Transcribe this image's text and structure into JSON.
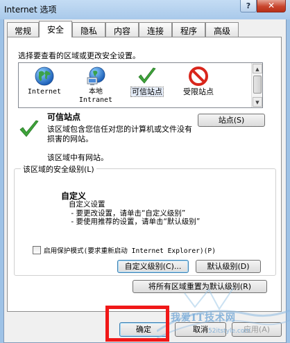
{
  "window": {
    "title": "Internet 选项",
    "help_label": "?",
    "close_label": "✕"
  },
  "tabs": [
    {
      "label": "常规"
    },
    {
      "label": "安全"
    },
    {
      "label": "隐私"
    },
    {
      "label": "内容"
    },
    {
      "label": "连接"
    },
    {
      "label": "程序"
    },
    {
      "label": "高级"
    }
  ],
  "active_tab": "安全",
  "zones": {
    "prompt": "选择要查看的区域或更改安全设置。",
    "items": [
      {
        "label": "Internet",
        "icon": "globe-icon"
      },
      {
        "label": "本地\nIntranet",
        "icon": "local-intranet-icon"
      },
      {
        "label": "可信站点",
        "icon": "check-icon",
        "selected": true
      },
      {
        "label": "受限站点",
        "icon": "no-entry-icon"
      }
    ],
    "selected": {
      "name": "可信站点",
      "description": "该区域包含您信任对您的计算机或文件没有损害的网站。",
      "sites_note": "该区域中有网站。",
      "sites_button": "站点(S)"
    }
  },
  "security_level": {
    "group_label": "该区域的安全级别(L)",
    "level_name": "自定义",
    "description_lines": [
      "自定义设置",
      " - 要更改设置，请单击“自定义级别”",
      " - 要使用推荐的设置，请单击“默认级别”"
    ],
    "protected_mode_label": "启用保护模式(要求重新启动 Internet Explorer)(P)",
    "protected_mode_checked": false,
    "custom_level_button": "自定义级别(C)...",
    "default_level_button": "默认级别(D)",
    "reset_all_button": "将所有区域重置为默认级别(R)"
  },
  "footer": {
    "ok": "确定",
    "cancel": "取消",
    "apply": "应用(A)"
  },
  "watermark": {
    "text": "我爱IT技术网",
    "url": "52itstyle.com"
  },
  "colors": {
    "highlight": "#f01818",
    "check_green": "#3ea33a",
    "no_entry_red": "#d9261c"
  }
}
